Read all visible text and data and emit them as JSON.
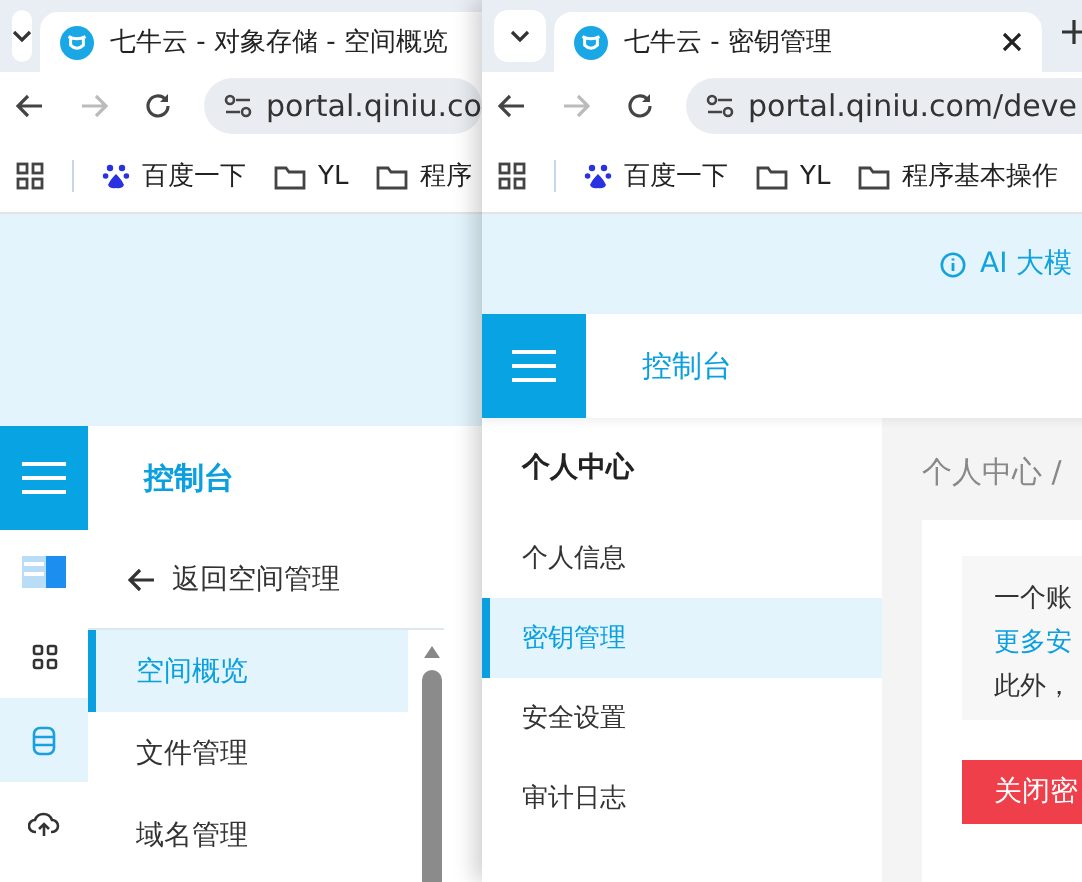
{
  "windows": [
    {
      "kind": "bucket",
      "tab": {
        "title": "七牛云 - 对象存储 - 空间概览",
        "selected": true
      },
      "url": "portal.qiniu.co",
      "bookmarks": [
        {
          "kind": "baidu",
          "label": "百度一下"
        },
        {
          "kind": "folder",
          "label": "YL"
        },
        {
          "kind": "folder",
          "label": "程序"
        }
      ],
      "header": {
        "title": "控制台"
      },
      "rail": [
        {
          "kind": "logo",
          "selected": false
        },
        {
          "kind": "grid",
          "selected": false
        },
        {
          "kind": "database",
          "selected": true
        },
        {
          "kind": "cloud",
          "selected": false
        }
      ],
      "back_link": "返回空间管理",
      "menu": [
        {
          "label": "空间概览",
          "selected": true
        },
        {
          "label": "文件管理",
          "selected": false
        },
        {
          "label": "域名管理",
          "selected": false
        }
      ]
    },
    {
      "kind": "account",
      "tab": {
        "title": "七牛云 - 密钥管理",
        "selected": true
      },
      "url": "portal.qiniu.com/deve",
      "bookmarks": [
        {
          "kind": "baidu",
          "label": "百度一下"
        },
        {
          "kind": "folder",
          "label": "YL"
        },
        {
          "kind": "folder",
          "label": "程序基本操作"
        }
      ],
      "banner": "AI 大模",
      "header": {
        "title": "控制台"
      },
      "sidebar": {
        "heading": "个人中心",
        "items": [
          {
            "label": "个人信息",
            "selected": false
          },
          {
            "label": "密钥管理",
            "selected": true
          },
          {
            "label": "安全设置",
            "selected": false
          },
          {
            "label": "审计日志",
            "selected": false
          }
        ]
      },
      "breadcrumb": "个人中心 /",
      "notice": [
        {
          "kind": "text",
          "text": "一个账"
        },
        {
          "kind": "link",
          "text": "更多安"
        },
        {
          "kind": "text",
          "text": "此外，"
        }
      ],
      "button": "关闭密"
    }
  ]
}
